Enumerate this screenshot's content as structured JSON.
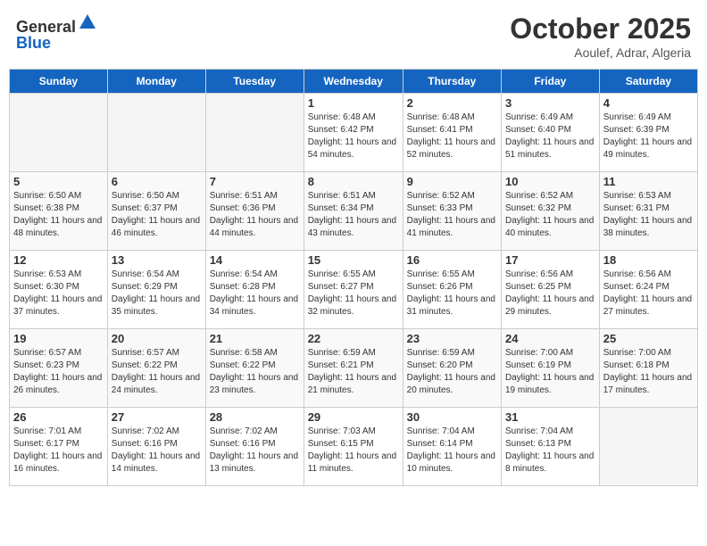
{
  "header": {
    "logo_general": "General",
    "logo_blue": "Blue",
    "month_title": "October 2025",
    "location": "Aoulef, Adrar, Algeria"
  },
  "days_of_week": [
    "Sunday",
    "Monday",
    "Tuesday",
    "Wednesday",
    "Thursday",
    "Friday",
    "Saturday"
  ],
  "weeks": [
    [
      {
        "day": "",
        "sunrise": "",
        "sunset": "",
        "daylight": ""
      },
      {
        "day": "",
        "sunrise": "",
        "sunset": "",
        "daylight": ""
      },
      {
        "day": "",
        "sunrise": "",
        "sunset": "",
        "daylight": ""
      },
      {
        "day": "1",
        "sunrise": "Sunrise: 6:48 AM",
        "sunset": "Sunset: 6:42 PM",
        "daylight": "Daylight: 11 hours and 54 minutes."
      },
      {
        "day": "2",
        "sunrise": "Sunrise: 6:48 AM",
        "sunset": "Sunset: 6:41 PM",
        "daylight": "Daylight: 11 hours and 52 minutes."
      },
      {
        "day": "3",
        "sunrise": "Sunrise: 6:49 AM",
        "sunset": "Sunset: 6:40 PM",
        "daylight": "Daylight: 11 hours and 51 minutes."
      },
      {
        "day": "4",
        "sunrise": "Sunrise: 6:49 AM",
        "sunset": "Sunset: 6:39 PM",
        "daylight": "Daylight: 11 hours and 49 minutes."
      }
    ],
    [
      {
        "day": "5",
        "sunrise": "Sunrise: 6:50 AM",
        "sunset": "Sunset: 6:38 PM",
        "daylight": "Daylight: 11 hours and 48 minutes."
      },
      {
        "day": "6",
        "sunrise": "Sunrise: 6:50 AM",
        "sunset": "Sunset: 6:37 PM",
        "daylight": "Daylight: 11 hours and 46 minutes."
      },
      {
        "day": "7",
        "sunrise": "Sunrise: 6:51 AM",
        "sunset": "Sunset: 6:36 PM",
        "daylight": "Daylight: 11 hours and 44 minutes."
      },
      {
        "day": "8",
        "sunrise": "Sunrise: 6:51 AM",
        "sunset": "Sunset: 6:34 PM",
        "daylight": "Daylight: 11 hours and 43 minutes."
      },
      {
        "day": "9",
        "sunrise": "Sunrise: 6:52 AM",
        "sunset": "Sunset: 6:33 PM",
        "daylight": "Daylight: 11 hours and 41 minutes."
      },
      {
        "day": "10",
        "sunrise": "Sunrise: 6:52 AM",
        "sunset": "Sunset: 6:32 PM",
        "daylight": "Daylight: 11 hours and 40 minutes."
      },
      {
        "day": "11",
        "sunrise": "Sunrise: 6:53 AM",
        "sunset": "Sunset: 6:31 PM",
        "daylight": "Daylight: 11 hours and 38 minutes."
      }
    ],
    [
      {
        "day": "12",
        "sunrise": "Sunrise: 6:53 AM",
        "sunset": "Sunset: 6:30 PM",
        "daylight": "Daylight: 11 hours and 37 minutes."
      },
      {
        "day": "13",
        "sunrise": "Sunrise: 6:54 AM",
        "sunset": "Sunset: 6:29 PM",
        "daylight": "Daylight: 11 hours and 35 minutes."
      },
      {
        "day": "14",
        "sunrise": "Sunrise: 6:54 AM",
        "sunset": "Sunset: 6:28 PM",
        "daylight": "Daylight: 11 hours and 34 minutes."
      },
      {
        "day": "15",
        "sunrise": "Sunrise: 6:55 AM",
        "sunset": "Sunset: 6:27 PM",
        "daylight": "Daylight: 11 hours and 32 minutes."
      },
      {
        "day": "16",
        "sunrise": "Sunrise: 6:55 AM",
        "sunset": "Sunset: 6:26 PM",
        "daylight": "Daylight: 11 hours and 31 minutes."
      },
      {
        "day": "17",
        "sunrise": "Sunrise: 6:56 AM",
        "sunset": "Sunset: 6:25 PM",
        "daylight": "Daylight: 11 hours and 29 minutes."
      },
      {
        "day": "18",
        "sunrise": "Sunrise: 6:56 AM",
        "sunset": "Sunset: 6:24 PM",
        "daylight": "Daylight: 11 hours and 27 minutes."
      }
    ],
    [
      {
        "day": "19",
        "sunrise": "Sunrise: 6:57 AM",
        "sunset": "Sunset: 6:23 PM",
        "daylight": "Daylight: 11 hours and 26 minutes."
      },
      {
        "day": "20",
        "sunrise": "Sunrise: 6:57 AM",
        "sunset": "Sunset: 6:22 PM",
        "daylight": "Daylight: 11 hours and 24 minutes."
      },
      {
        "day": "21",
        "sunrise": "Sunrise: 6:58 AM",
        "sunset": "Sunset: 6:22 PM",
        "daylight": "Daylight: 11 hours and 23 minutes."
      },
      {
        "day": "22",
        "sunrise": "Sunrise: 6:59 AM",
        "sunset": "Sunset: 6:21 PM",
        "daylight": "Daylight: 11 hours and 21 minutes."
      },
      {
        "day": "23",
        "sunrise": "Sunrise: 6:59 AM",
        "sunset": "Sunset: 6:20 PM",
        "daylight": "Daylight: 11 hours and 20 minutes."
      },
      {
        "day": "24",
        "sunrise": "Sunrise: 7:00 AM",
        "sunset": "Sunset: 6:19 PM",
        "daylight": "Daylight: 11 hours and 19 minutes."
      },
      {
        "day": "25",
        "sunrise": "Sunrise: 7:00 AM",
        "sunset": "Sunset: 6:18 PM",
        "daylight": "Daylight: 11 hours and 17 minutes."
      }
    ],
    [
      {
        "day": "26",
        "sunrise": "Sunrise: 7:01 AM",
        "sunset": "Sunset: 6:17 PM",
        "daylight": "Daylight: 11 hours and 16 minutes."
      },
      {
        "day": "27",
        "sunrise": "Sunrise: 7:02 AM",
        "sunset": "Sunset: 6:16 PM",
        "daylight": "Daylight: 11 hours and 14 minutes."
      },
      {
        "day": "28",
        "sunrise": "Sunrise: 7:02 AM",
        "sunset": "Sunset: 6:16 PM",
        "daylight": "Daylight: 11 hours and 13 minutes."
      },
      {
        "day": "29",
        "sunrise": "Sunrise: 7:03 AM",
        "sunset": "Sunset: 6:15 PM",
        "daylight": "Daylight: 11 hours and 11 minutes."
      },
      {
        "day": "30",
        "sunrise": "Sunrise: 7:04 AM",
        "sunset": "Sunset: 6:14 PM",
        "daylight": "Daylight: 11 hours and 10 minutes."
      },
      {
        "day": "31",
        "sunrise": "Sunrise: 7:04 AM",
        "sunset": "Sunset: 6:13 PM",
        "daylight": "Daylight: 11 hours and 8 minutes."
      },
      {
        "day": "",
        "sunrise": "",
        "sunset": "",
        "daylight": ""
      }
    ]
  ]
}
